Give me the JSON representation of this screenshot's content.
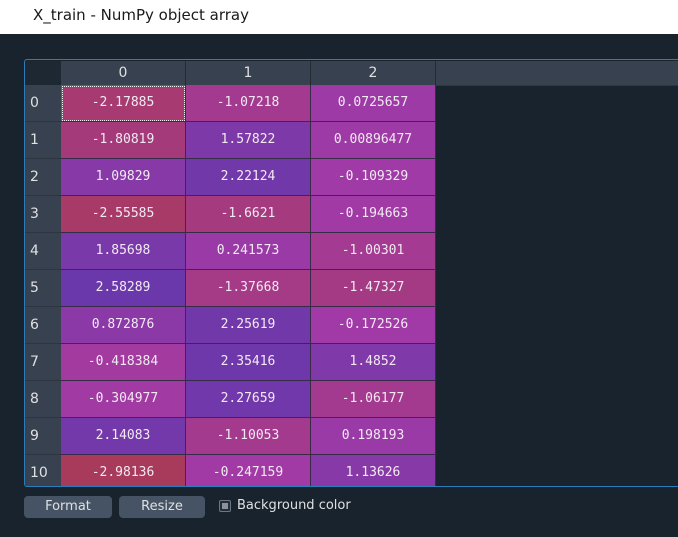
{
  "window": {
    "title": "X_train - NumPy object array"
  },
  "table": {
    "columns": [
      "0",
      "1",
      "2"
    ],
    "rows": [
      {
        "index": "0",
        "values": [
          "-2.17885",
          "-1.07218",
          "0.0725657"
        ]
      },
      {
        "index": "1",
        "values": [
          "-1.80819",
          "1.57822",
          "0.00896477"
        ]
      },
      {
        "index": "2",
        "values": [
          "1.09829",
          "2.22124",
          "-0.109329"
        ]
      },
      {
        "index": "3",
        "values": [
          "-2.55585",
          "-1.6621",
          "-0.194663"
        ]
      },
      {
        "index": "4",
        "values": [
          "1.85698",
          "0.241573",
          "-1.00301"
        ]
      },
      {
        "index": "5",
        "values": [
          "2.58289",
          "-1.37668",
          "-1.47327"
        ]
      },
      {
        "index": "6",
        "values": [
          "0.872876",
          "2.25619",
          "-0.172526"
        ]
      },
      {
        "index": "7",
        "values": [
          "-0.418384",
          "2.35416",
          "1.4852"
        ]
      },
      {
        "index": "8",
        "values": [
          "-0.304977",
          "2.27659",
          "-1.06177"
        ]
      },
      {
        "index": "9",
        "values": [
          "2.14083",
          "-1.10053",
          "0.198193"
        ]
      },
      {
        "index": "10",
        "values": [
          "-2.98136",
          "-0.247159",
          "1.13626"
        ]
      }
    ],
    "selected_cell": {
      "row": 0,
      "col": 0
    },
    "colormap": {
      "min_color": "#a83a5c",
      "mid_color": "#a23aa6",
      "max_color": "#6a38aa",
      "min": -2.98136,
      "max": 2.58289
    }
  },
  "toolbar": {
    "format_label": "Format",
    "resize_label": "Resize",
    "background_color_label": "Background color",
    "background_color_checked": "partial"
  },
  "theme": {
    "background": "#19232d",
    "header_bg": "#37414f",
    "frame_border": "#2a7db8",
    "button_bg": "#455364"
  }
}
